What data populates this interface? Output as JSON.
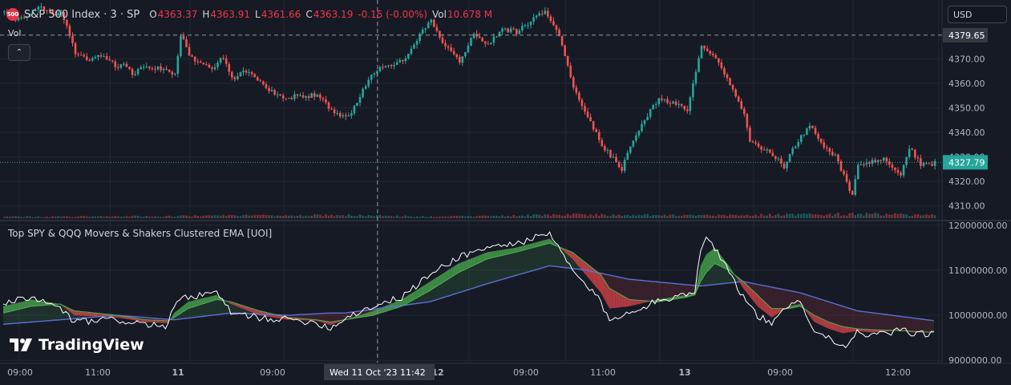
{
  "header": {
    "logo_text": "500",
    "symbol": "S&P 500 Index · 3 · SP",
    "ohlc": [
      {
        "k": "O",
        "v": "4363.37"
      },
      {
        "k": "H",
        "v": "4363.91"
      },
      {
        "k": "L",
        "v": "4361.66"
      },
      {
        "k": "C",
        "v": "4363.19"
      },
      {
        "k": "",
        "v": "-0.15 (-0.00%)"
      }
    ],
    "vol_label": "Vol",
    "vol_value": "10.678 M"
  },
  "currency": "USD",
  "vol_pane_label": "Vol",
  "collapse_glyph": "⌃",
  "indicator_title": "Top SPY & QQQ Movers & Shakers Clustered EMA [UOI]",
  "branding": "TradingView",
  "crosshair_time": "Wed 11 Oct '23   11:42",
  "colors": {
    "bg": "#161a25",
    "up": "#26a69a",
    "down": "#ef5350",
    "grid": "#232733",
    "bull_fill": "#4caf50",
    "bear_fill": "#e0454a",
    "slow_ema": "#5c6fd6",
    "raw_line": "#ffffff",
    "last_price_bg": "#26a69a"
  },
  "chart_data": [
    {
      "type": "candlestick",
      "title": "S&P 500 Index · 3 · SP",
      "ylim": [
        4305,
        4393
      ],
      "yticks": [
        "4310.00",
        "4320.00",
        "4330.00",
        "4340.00",
        "4350.00",
        "4360.00",
        "4370.00"
      ],
      "crosshair_price": "4379.65",
      "last_price": "4327.79",
      "xticks": [
        "09:00",
        "11:00",
        "11",
        "09:00",
        "12",
        "09:00",
        "11:00",
        "13",
        "09:00",
        "12:00"
      ],
      "close_path": [
        [
          0,
          4389
        ],
        [
          5,
          4386
        ],
        [
          12,
          4391
        ],
        [
          20,
          4388
        ],
        [
          22,
          4383
        ],
        [
          25,
          4372
        ],
        [
          30,
          4370
        ],
        [
          35,
          4371
        ],
        [
          40,
          4366
        ],
        [
          42,
          4368
        ],
        [
          45,
          4364
        ],
        [
          50,
          4367
        ],
        [
          55,
          4366
        ],
        [
          60,
          4363
        ],
        [
          62,
          4380
        ],
        [
          63,
          4377
        ],
        [
          65,
          4371
        ],
        [
          70,
          4367
        ],
        [
          73,
          4366
        ],
        [
          77,
          4371
        ],
        [
          80,
          4362
        ],
        [
          85,
          4365
        ],
        [
          90,
          4360
        ],
        [
          95,
          4356
        ],
        [
          100,
          4354
        ],
        [
          103,
          4355
        ],
        [
          110,
          4355
        ],
        [
          115,
          4349
        ],
        [
          120,
          4346
        ],
        [
          123,
          4350
        ],
        [
          126,
          4357
        ],
        [
          130,
          4365
        ],
        [
          135,
          4367
        ],
        [
          140,
          4369
        ],
        [
          145,
          4378
        ],
        [
          150,
          4386
        ],
        [
          155,
          4375
        ],
        [
          160,
          4369
        ],
        [
          165,
          4380
        ],
        [
          170,
          4376
        ],
        [
          175,
          4382
        ],
        [
          180,
          4381
        ],
        [
          190,
          4390
        ],
        [
          195,
          4380
        ],
        [
          200,
          4358
        ],
        [
          210,
          4335
        ],
        [
          217,
          4325
        ],
        [
          220,
          4335
        ],
        [
          225,
          4345
        ],
        [
          230,
          4354
        ],
        [
          235,
          4352
        ],
        [
          240,
          4349
        ],
        [
          245,
          4375
        ],
        [
          250,
          4370
        ],
        [
          255,
          4359
        ],
        [
          260,
          4348
        ],
        [
          262,
          4337
        ],
        [
          265,
          4334
        ],
        [
          270,
          4331
        ],
        [
          274,
          4326
        ],
        [
          278,
          4335
        ],
        [
          283,
          4343
        ],
        [
          287,
          4335
        ],
        [
          292,
          4330
        ],
        [
          296,
          4320
        ],
        [
          298,
          4314
        ],
        [
          300,
          4327
        ],
        [
          305,
          4328
        ],
        [
          310,
          4329
        ],
        [
          315,
          4322
        ],
        [
          318,
          4334
        ],
        [
          322,
          4327
        ],
        [
          326,
          4326
        ],
        [
          327,
          4327.79
        ]
      ],
      "volume_path": [
        [
          0,
          0.15
        ],
        [
          60,
          0.2
        ],
        [
          120,
          0.3
        ],
        [
          150,
          0.15
        ],
        [
          200,
          0.35
        ],
        [
          245,
          0.25
        ],
        [
          300,
          0.4
        ],
        [
          327,
          0.3
        ]
      ]
    },
    {
      "type": "area",
      "title": "Top SPY & QQQ Movers & Shakers Clustered EMA [UOI]",
      "ylim": [
        8950000,
        12050000
      ],
      "yticks": [
        "12000000.00",
        "11000000.00",
        "10000000.00",
        "9000000.00"
      ],
      "raw": [
        [
          0,
          10250000
        ],
        [
          10,
          10400000
        ],
        [
          20,
          10150000
        ],
        [
          25,
          9850000
        ],
        [
          40,
          9900000
        ],
        [
          50,
          9800000
        ],
        [
          58,
          9750000
        ],
        [
          60,
          10250000
        ],
        [
          65,
          10400000
        ],
        [
          75,
          10500000
        ],
        [
          80,
          10050000
        ],
        [
          90,
          9950000
        ],
        [
          100,
          9900000
        ],
        [
          110,
          9850000
        ],
        [
          115,
          9700000
        ],
        [
          120,
          9950000
        ],
        [
          130,
          10200000
        ],
        [
          140,
          10400000
        ],
        [
          150,
          10900000
        ],
        [
          160,
          11300000
        ],
        [
          170,
          11500000
        ],
        [
          180,
          11600000
        ],
        [
          192,
          11800000
        ],
        [
          200,
          11000000
        ],
        [
          210,
          10300000
        ],
        [
          213,
          9850000
        ],
        [
          220,
          10100000
        ],
        [
          230,
          10300000
        ],
        [
          240,
          10500000
        ],
        [
          243,
          10550000
        ],
        [
          245,
          11400000
        ],
        [
          247,
          11800000
        ],
        [
          250,
          11500000
        ],
        [
          255,
          11000000
        ],
        [
          260,
          10400000
        ],
        [
          265,
          10000000
        ],
        [
          270,
          9800000
        ],
        [
          276,
          10200000
        ],
        [
          280,
          10300000
        ],
        [
          285,
          9700000
        ],
        [
          290,
          9500000
        ],
        [
          295,
          9300000
        ],
        [
          300,
          9600000
        ],
        [
          305,
          9550000
        ],
        [
          310,
          9600000
        ],
        [
          315,
          9650000
        ],
        [
          320,
          9600000
        ],
        [
          327,
          9600000
        ]
      ],
      "fast": [
        [
          0,
          10200000
        ],
        [
          10,
          10350000
        ],
        [
          20,
          10250000
        ],
        [
          25,
          10000000
        ],
        [
          40,
          9950000
        ],
        [
          50,
          9850000
        ],
        [
          58,
          9820000
        ],
        [
          60,
          10050000
        ],
        [
          65,
          10300000
        ],
        [
          75,
          10450000
        ],
        [
          80,
          10250000
        ],
        [
          90,
          10000000
        ],
        [
          100,
          9900000
        ],
        [
          110,
          9880000
        ],
        [
          115,
          9780000
        ],
        [
          120,
          9900000
        ],
        [
          130,
          10100000
        ],
        [
          140,
          10350000
        ],
        [
          150,
          10750000
        ],
        [
          160,
          11150000
        ],
        [
          170,
          11400000
        ],
        [
          180,
          11500000
        ],
        [
          192,
          11700000
        ],
        [
          200,
          11250000
        ],
        [
          210,
          10500000
        ],
        [
          213,
          10150000
        ],
        [
          220,
          10200000
        ],
        [
          230,
          10350000
        ],
        [
          240,
          10450000
        ],
        [
          243,
          10500000
        ],
        [
          245,
          11100000
        ],
        [
          247,
          11350000
        ],
        [
          250,
          11500000
        ],
        [
          255,
          11100000
        ],
        [
          260,
          10600000
        ],
        [
          265,
          10200000
        ],
        [
          270,
          9950000
        ],
        [
          276,
          10200000
        ],
        [
          280,
          10250000
        ],
        [
          285,
          9850000
        ],
        [
          290,
          9700000
        ],
        [
          295,
          9600000
        ],
        [
          300,
          9650000
        ],
        [
          305,
          9620000
        ],
        [
          310,
          9640000
        ],
        [
          315,
          9660000
        ],
        [
          320,
          9620000
        ],
        [
          327,
          9620000
        ]
      ],
      "mid": [
        [
          0,
          10050000
        ],
        [
          10,
          10200000
        ],
        [
          20,
          10250000
        ],
        [
          25,
          10100000
        ],
        [
          40,
          10000000
        ],
        [
          50,
          9900000
        ],
        [
          58,
          9880000
        ],
        [
          60,
          9950000
        ],
        [
          65,
          10150000
        ],
        [
          75,
          10350000
        ],
        [
          80,
          10300000
        ],
        [
          90,
          10100000
        ],
        [
          100,
          9950000
        ],
        [
          110,
          9900000
        ],
        [
          115,
          9850000
        ],
        [
          120,
          9900000
        ],
        [
          130,
          10000000
        ],
        [
          140,
          10200000
        ],
        [
          150,
          10550000
        ],
        [
          160,
          10950000
        ],
        [
          170,
          11250000
        ],
        [
          180,
          11400000
        ],
        [
          192,
          11600000
        ],
        [
          200,
          11400000
        ],
        [
          210,
          10900000
        ],
        [
          213,
          10600000
        ],
        [
          220,
          10350000
        ],
        [
          230,
          10300000
        ],
        [
          240,
          10400000
        ],
        [
          243,
          10450000
        ],
        [
          245,
          10750000
        ],
        [
          247,
          10950000
        ],
        [
          250,
          11150000
        ],
        [
          255,
          11000000
        ],
        [
          260,
          10750000
        ],
        [
          265,
          10450000
        ],
        [
          270,
          10150000
        ],
        [
          276,
          10150000
        ],
        [
          280,
          10200000
        ],
        [
          285,
          10000000
        ],
        [
          290,
          9850000
        ],
        [
          295,
          9750000
        ],
        [
          300,
          9700000
        ],
        [
          305,
          9680000
        ],
        [
          310,
          9670000
        ],
        [
          315,
          9660000
        ],
        [
          320,
          9640000
        ],
        [
          327,
          9620000
        ]
      ],
      "slow": [
        [
          0,
          9800000
        ],
        [
          20,
          9900000
        ],
        [
          40,
          10000000
        ],
        [
          60,
          9900000
        ],
        [
          80,
          10050000
        ],
        [
          100,
          10000000
        ],
        [
          115,
          10050000
        ],
        [
          120,
          10050000
        ],
        [
          150,
          10300000
        ],
        [
          170,
          10700000
        ],
        [
          192,
          11100000
        ],
        [
          205,
          11000000
        ],
        [
          220,
          10800000
        ],
        [
          245,
          10650000
        ],
        [
          260,
          10750000
        ],
        [
          280,
          10500000
        ],
        [
          300,
          10100000
        ],
        [
          327,
          9880000
        ]
      ]
    }
  ]
}
